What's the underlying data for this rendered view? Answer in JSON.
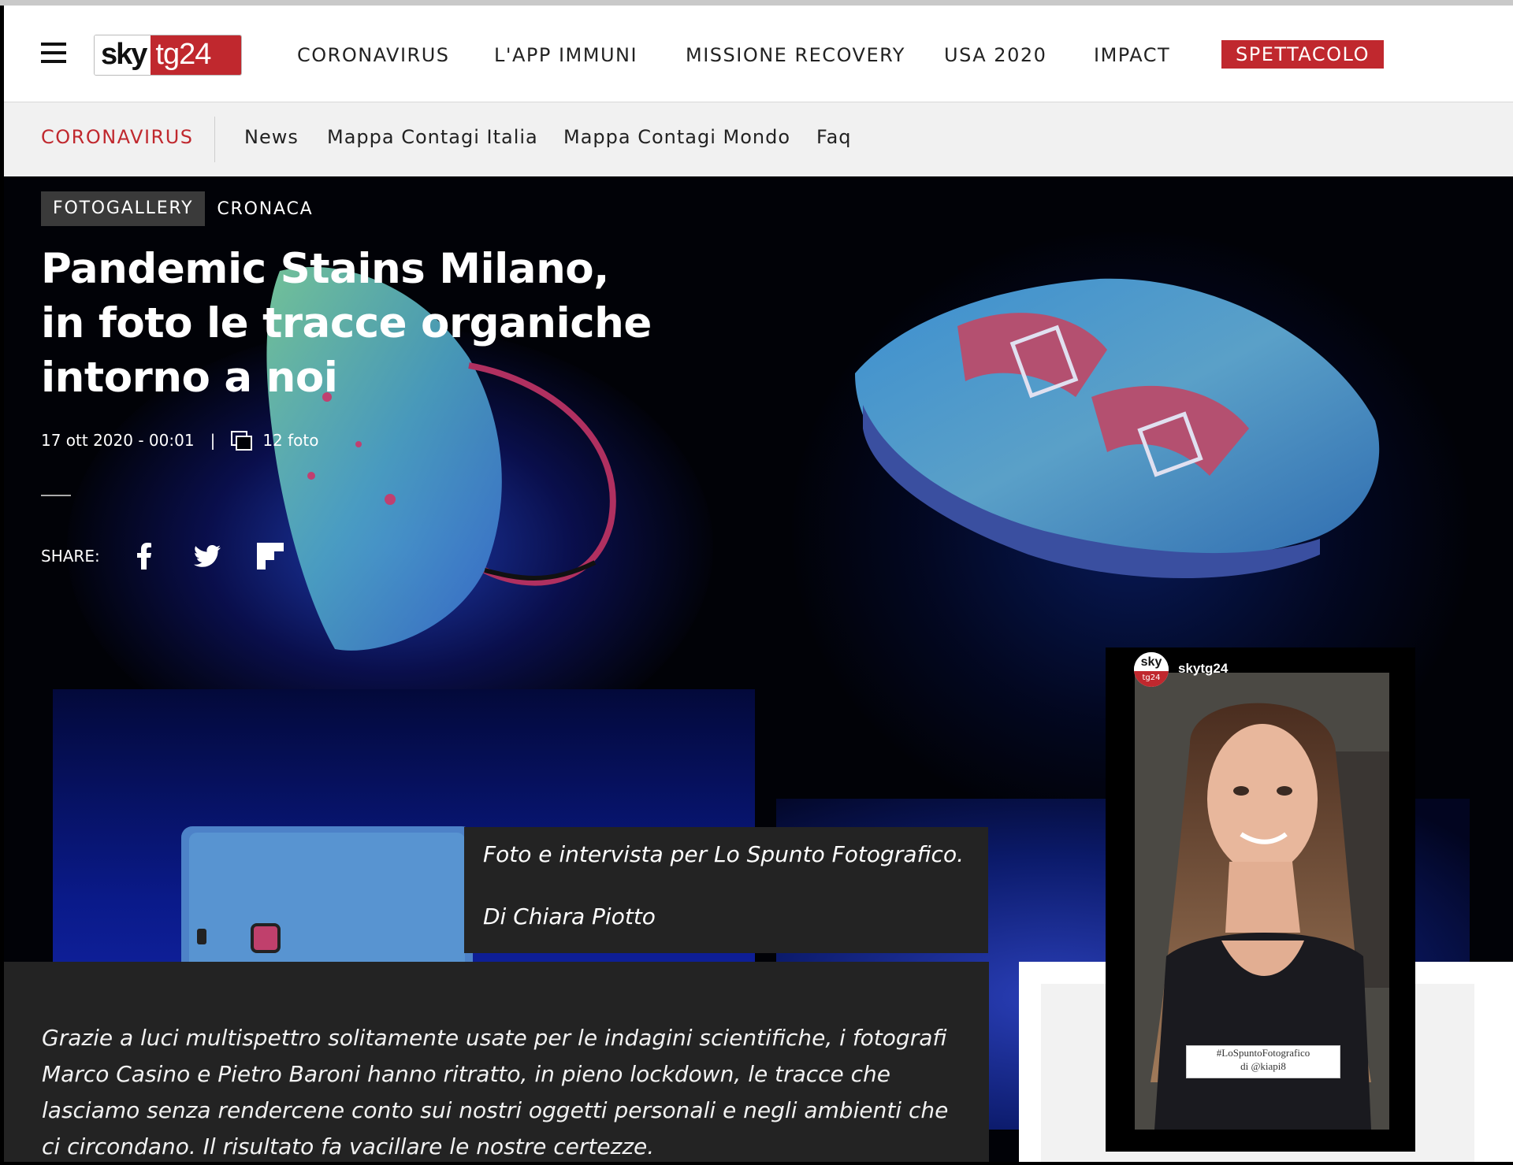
{
  "header": {
    "logo_left": "sky",
    "logo_right": "tg24",
    "nav": [
      {
        "label": "CORONAVIRUS"
      },
      {
        "label": "L'APP IMMUNI"
      },
      {
        "label": "MISSIONE RECOVERY"
      },
      {
        "label": "USA 2020"
      },
      {
        "label": "IMPACT"
      },
      {
        "label": "SPETTACOLO"
      }
    ],
    "accent_color": "#c0282e"
  },
  "subnav": {
    "section": "CORONAVIRUS",
    "links": [
      "News",
      "Mappa Contagi Italia",
      "Mappa Contagi Mondo",
      "Faq"
    ]
  },
  "article": {
    "badge": "FOTOGALLERY",
    "category": "CRONACA",
    "title": "Pandemic Stains Milano, in foto le tracce organiche intorno a noi",
    "date": "17 ott 2020 - 00:01",
    "separator": "|",
    "photo_count": "12 foto",
    "share_label": "SHARE:",
    "share_icons": [
      "facebook-icon",
      "twitter-icon",
      "flipboard-icon"
    ],
    "caption_line1": "Foto e intervista per Lo Spunto Fotografico.",
    "caption_line2": "Di Chiara Piotto",
    "description": "Grazie a luci multispettro solitamente usate per le indagini scientifiche, i fotografi Marco Casino e Pietro Baroni hanno ritratto, in pieno lockdown, le tracce che lasciamo senza rendercene conto sui nostri oggetti personali e negli ambienti che ci circondano. Il risultato fa vacillare le nostre certezze."
  },
  "video": {
    "avatar_top": "sky",
    "avatar_bottom": "tg24",
    "username": "skytg24",
    "tag_line1": "#LoSpuntoFotografico",
    "tag_line2": "di @kiapi8"
  }
}
